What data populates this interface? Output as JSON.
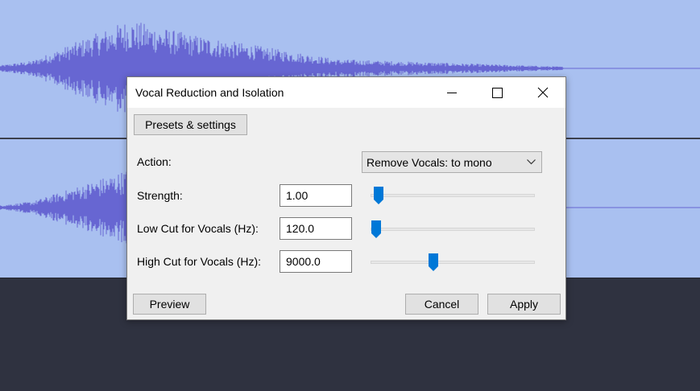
{
  "dialog": {
    "title": "Vocal Reduction and Isolation",
    "presets_label": "Presets & settings",
    "action": {
      "label": "Action:",
      "value": "Remove Vocals: to mono"
    },
    "strength": {
      "label": "Strength:",
      "value": "1.00",
      "slider_fraction": 0.05
    },
    "low_cut": {
      "label": "Low Cut for Vocals (Hz):",
      "value": "120.0",
      "slider_fraction": 0.035
    },
    "high_cut": {
      "label": "High Cut for Vocals (Hz):",
      "value": "9000.0",
      "slider_fraction": 0.38
    },
    "preview_label": "Preview",
    "cancel_label": "Cancel",
    "apply_label": "Apply",
    "icons": {
      "minimize": "minimize-icon",
      "maximize": "maximize-icon",
      "close": "close-icon",
      "dropdown": "chevron-down-icon"
    }
  },
  "colors": {
    "track_background": "#a9c0f0",
    "waveform": "#6766d2",
    "panel_background": "#2f3240",
    "slider_thumb": "#0078d7"
  }
}
